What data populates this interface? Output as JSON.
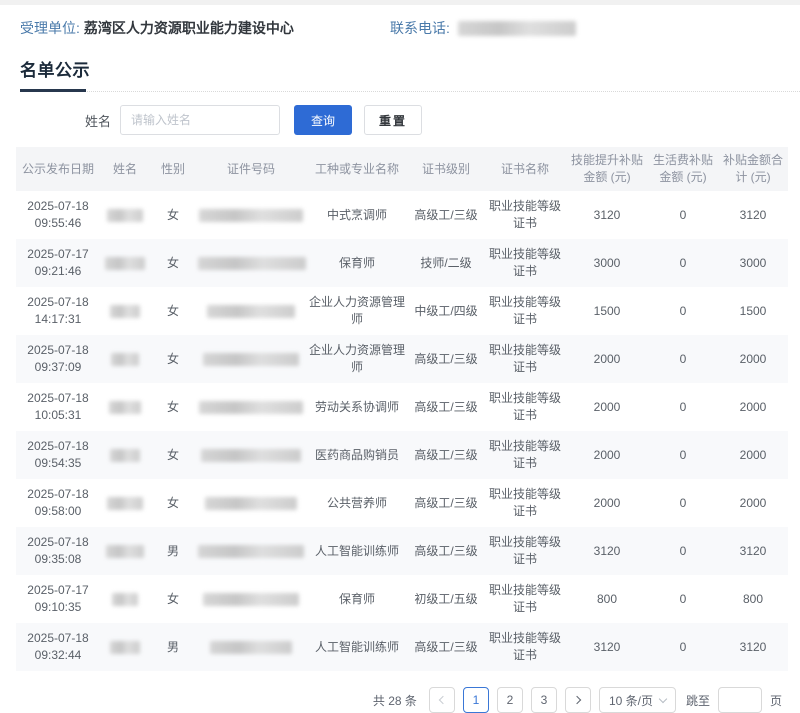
{
  "topbar": {
    "unit_label": "受理单位:",
    "unit_value": "荔湾区人力资源职业能力建设中心",
    "phone_label": "联系电话:"
  },
  "title": "名单公示",
  "search": {
    "name_label": "姓名",
    "name_placeholder": "请输入姓名",
    "query": "查询",
    "reset": "重置"
  },
  "table": {
    "headers": [
      "公示发布日期",
      "姓名",
      "性别",
      "证件号码",
      "工种或专业名称",
      "证书级别",
      "证书名称",
      "技能提升补贴金额 (元)",
      "生活费补贴金额 (元)",
      "补贴金额合计 (元)"
    ],
    "rows": [
      {
        "date": "2025-07-18",
        "time": "09:55:46",
        "gender": "女",
        "job": "中式烹调师",
        "level": "高级工/三级",
        "cert": "职业技能等级证书",
        "skill": "3120",
        "living": "0",
        "total": "3120"
      },
      {
        "date": "2025-07-17",
        "time": "09:21:46",
        "gender": "女",
        "job": "保育师",
        "level": "技师/二级",
        "cert": "职业技能等级证书",
        "skill": "3000",
        "living": "0",
        "total": "3000"
      },
      {
        "date": "2025-07-18",
        "time": "14:17:31",
        "gender": "女",
        "job": "企业人力资源管理师",
        "level": "中级工/四级",
        "cert": "职业技能等级证书",
        "skill": "1500",
        "living": "0",
        "total": "1500"
      },
      {
        "date": "2025-07-18",
        "time": "09:37:09",
        "gender": "女",
        "job": "企业人力资源管理师",
        "level": "高级工/三级",
        "cert": "职业技能等级证书",
        "skill": "2000",
        "living": "0",
        "total": "2000"
      },
      {
        "date": "2025-07-18",
        "time": "10:05:31",
        "gender": "女",
        "job": "劳动关系协调师",
        "level": "高级工/三级",
        "cert": "职业技能等级证书",
        "skill": "2000",
        "living": "0",
        "total": "2000"
      },
      {
        "date": "2025-07-18",
        "time": "09:54:35",
        "gender": "女",
        "job": "医药商品购销员",
        "level": "高级工/三级",
        "cert": "职业技能等级证书",
        "skill": "2000",
        "living": "0",
        "total": "2000"
      },
      {
        "date": "2025-07-18",
        "time": "09:58:00",
        "gender": "女",
        "job": "公共营养师",
        "level": "高级工/三级",
        "cert": "职业技能等级证书",
        "skill": "2000",
        "living": "0",
        "total": "2000"
      },
      {
        "date": "2025-07-18",
        "time": "09:35:08",
        "gender": "男",
        "job": "人工智能训练师",
        "level": "高级工/三级",
        "cert": "职业技能等级证书",
        "skill": "3120",
        "living": "0",
        "total": "3120"
      },
      {
        "date": "2025-07-17",
        "time": "09:10:35",
        "gender": "女",
        "job": "保育师",
        "level": "初级工/五级",
        "cert": "职业技能等级证书",
        "skill": "800",
        "living": "0",
        "total": "800"
      },
      {
        "date": "2025-07-18",
        "time": "09:32:44",
        "gender": "男",
        "job": "人工智能训练师",
        "level": "高级工/三级",
        "cert": "职业技能等级证书",
        "skill": "3120",
        "living": "0",
        "total": "3120"
      }
    ]
  },
  "pagination": {
    "total": "共 28 条",
    "pages": [
      "1",
      "2",
      "3"
    ],
    "active_page": "1",
    "page_size": "10 条/页",
    "jump_label": "跳至",
    "page_suffix": "页"
  },
  "colors": {
    "accent_blue": "#2e6bd5",
    "label_blue": "#4a7aaa",
    "title_dark": "#1b2a3a",
    "table_header_bg": "#f4f5f7",
    "stripe_bg": "#f8f9fb",
    "active_page_blue": "#3a77d6"
  }
}
